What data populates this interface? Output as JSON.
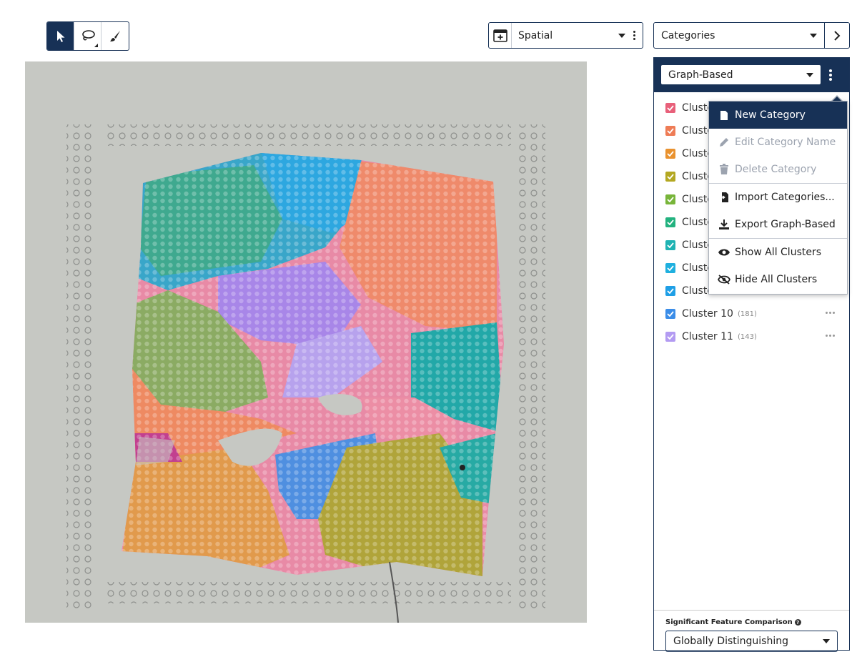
{
  "toolbar": {
    "tools": [
      {
        "name": "select-tool",
        "icon": "cursor-icon",
        "active": true
      },
      {
        "name": "lasso-tool",
        "icon": "lasso-icon",
        "active": false
      },
      {
        "name": "brush-tool",
        "icon": "brush-icon",
        "active": false
      }
    ]
  },
  "view": {
    "icon": "add-panel-icon",
    "label": "Spatial"
  },
  "categories_select": {
    "label": "Categories"
  },
  "panel": {
    "category_select": "Graph-Based",
    "clusters": [
      {
        "label": "Cluster 1",
        "count": "",
        "color": "#e8607a"
      },
      {
        "label": "Cluster 2",
        "count": "",
        "color": "#ee7c56"
      },
      {
        "label": "Cluster 3",
        "count": "",
        "color": "#e9922f"
      },
      {
        "label": "Cluster 4",
        "count": "",
        "color": "#b4a822"
      },
      {
        "label": "Cluster 5",
        "count": "",
        "color": "#78b53a"
      },
      {
        "label": "Cluster 6",
        "count": "",
        "color": "#23b27f"
      },
      {
        "label": "Cluster 7",
        "count": "",
        "color": "#1fb3b3"
      },
      {
        "label": "Cluster 8",
        "count": "",
        "color": "#1fb0df"
      },
      {
        "label": "Cluster 9",
        "count": "",
        "color": "#1f9fe6"
      },
      {
        "label": "Cluster 10",
        "count": "(181)",
        "color": "#3b8de8"
      },
      {
        "label": "Cluster 11",
        "count": "(143)",
        "color": "#b39bf2"
      }
    ],
    "footer_title": "Significant Feature Comparison",
    "footer_select": "Globally Distinguishing"
  },
  "context_menu": {
    "new_category": "New Category",
    "edit_category_name": "Edit Category Name",
    "delete_category": "Delete Category",
    "import_categories": "Import Categories...",
    "export": "Export Graph-Based",
    "show_all": "Show All Clusters",
    "hide_all": "Hide All Clusters"
  },
  "colors": {
    "navy": "#173156",
    "tissue_background": "#c6c8c3"
  }
}
